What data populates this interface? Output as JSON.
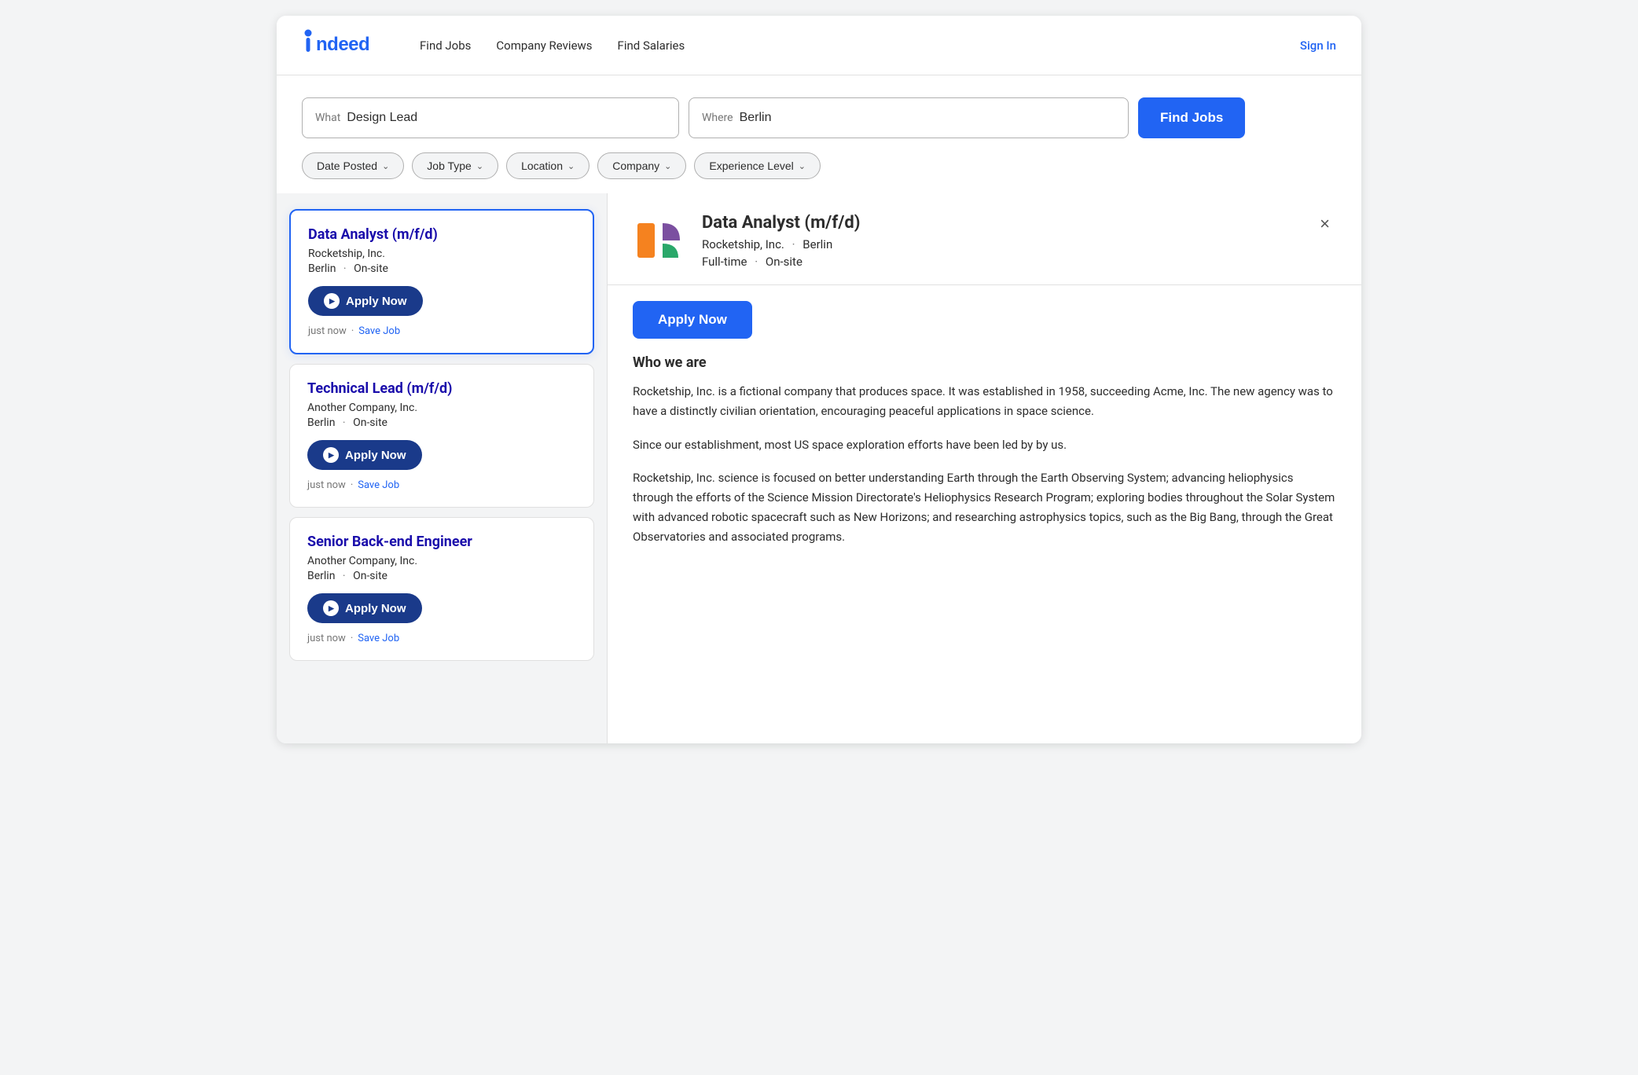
{
  "header": {
    "logo": "indeed",
    "nav": [
      {
        "label": "Find Jobs",
        "id": "find-jobs"
      },
      {
        "label": "Company Reviews",
        "id": "company-reviews"
      },
      {
        "label": "Find Salaries",
        "id": "find-salaries"
      }
    ],
    "sign_in_label": "Sign In"
  },
  "search": {
    "what_label": "What",
    "what_value": "Design Lead",
    "where_label": "Where",
    "where_value": "Berlin",
    "find_jobs_label": "Find Jobs"
  },
  "filters": [
    {
      "label": "Date Posted",
      "id": "date-posted"
    },
    {
      "label": "Job Type",
      "id": "job-type"
    },
    {
      "label": "Location",
      "id": "location"
    },
    {
      "label": "Company",
      "id": "company"
    },
    {
      "label": "Experience Level",
      "id": "experience-level"
    }
  ],
  "jobs": [
    {
      "id": "job-1",
      "title": "Data Analyst (m/f/d)",
      "company": "Rocketship, Inc.",
      "location": "Berlin",
      "work_type": "On-site",
      "apply_label": "Apply Now",
      "timestamp": "just now",
      "save_label": "Save Job",
      "selected": true
    },
    {
      "id": "job-2",
      "title": "Technical Lead (m/f/d)",
      "company": "Another Company, Inc.",
      "location": "Berlin",
      "work_type": "On-site",
      "apply_label": "Apply Now",
      "timestamp": "just now",
      "save_label": "Save Job",
      "selected": false
    },
    {
      "id": "job-3",
      "title": "Senior Back-end Engineer",
      "company": "Another Company, Inc.",
      "location": "Berlin",
      "work_type": "On-site",
      "apply_label": "Apply Now",
      "timestamp": "just now",
      "save_label": "Save Job",
      "selected": false
    }
  ],
  "detail": {
    "title": "Data Analyst (m/f/d)",
    "company": "Rocketship, Inc.",
    "location": "Berlin",
    "job_type": "Full-time",
    "work_type": "On-site",
    "apply_label": "Apply Now",
    "close_icon": "×",
    "who_we_are_title": "Who we are",
    "paragraphs": [
      "Rocketship, Inc. is a fictional company that produces space. It was established in 1958, succeeding Acme, Inc. The new agency was to have a distinctly civilian orientation, encouraging peaceful applications in space science.",
      "Since our establishment, most US space exploration efforts have been led by by us.",
      "Rocketship, Inc. science is focused on better understanding Earth through the Earth Observing System; advancing heliophysics through the efforts of the Science Mission Directorate's Heliophysics Research Program; exploring bodies throughout the Solar System with advanced robotic spacecraft such as New Horizons; and researching astrophysics topics, such as the Big Bang, through the Great Observatories and associated programs."
    ]
  },
  "colors": {
    "primary": "#2164f3",
    "dark_blue": "#1a3a8a",
    "text": "#2d2d2d",
    "gray": "#767676",
    "border": "#e0e0e0",
    "bg": "#f3f4f5"
  }
}
